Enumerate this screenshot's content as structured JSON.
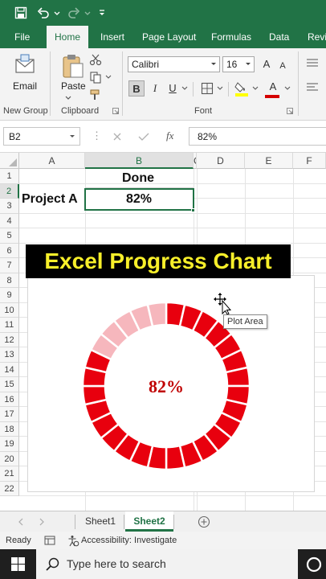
{
  "quick_access": {
    "icons": [
      "save-icon",
      "undo-icon",
      "redo-icon",
      "customize-quick-access-icon"
    ]
  },
  "tabs": [
    {
      "label": "File"
    },
    {
      "label": "Home"
    },
    {
      "label": "Insert"
    },
    {
      "label": "Page Layout"
    },
    {
      "label": "Formulas"
    },
    {
      "label": "Data"
    },
    {
      "label": "Revie"
    }
  ],
  "ribbon": {
    "email_label": "Email",
    "new_group_label": "New Group",
    "paste_label": "Paste",
    "clipboard_label": "Clipboard",
    "font_name": "Calibri",
    "font_size": "16",
    "grow_font": "A",
    "shrink_font": "A",
    "bold": "B",
    "italic": "I",
    "underline": "U",
    "font_color_letter": "A",
    "font_group_label": "Font",
    "highlight_color": "#ffff00",
    "font_color": "#d40000"
  },
  "formula_bar": {
    "name_box": "B2",
    "fx": "fx",
    "value": "82%"
  },
  "columns": [
    "A",
    "B",
    "C",
    "D",
    "E",
    "F"
  ],
  "rows": [
    "1",
    "2",
    "3",
    "4",
    "5",
    "6",
    "7",
    "8",
    "9",
    "10",
    "11",
    "12",
    "13",
    "14",
    "15",
    "16",
    "17",
    "18",
    "19",
    "20",
    "21",
    "22"
  ],
  "cells": {
    "b1": "Done",
    "a2": "Project A",
    "b2": "82%"
  },
  "overlay_title": "Excel Progress Chart",
  "chart_data": {
    "type": "pie",
    "subtype": "doughnut",
    "total_segments": 28,
    "filled_segments": 23,
    "values": [
      82,
      18
    ],
    "center_label": "82%",
    "filled_color": "#e8000e",
    "empty_color": "#f6b7bd"
  },
  "tooltip": "Plot Area",
  "sheets": [
    {
      "label": "Sheet1"
    },
    {
      "label": "Sheet2"
    }
  ],
  "status": {
    "ready": "Ready",
    "accessibility": "Accessibility: Investigate"
  },
  "taskbar": {
    "search_placeholder": "Type here to search"
  },
  "colors": {
    "excel_green": "#217346",
    "taskbar_bg": "#1f1f1f"
  }
}
